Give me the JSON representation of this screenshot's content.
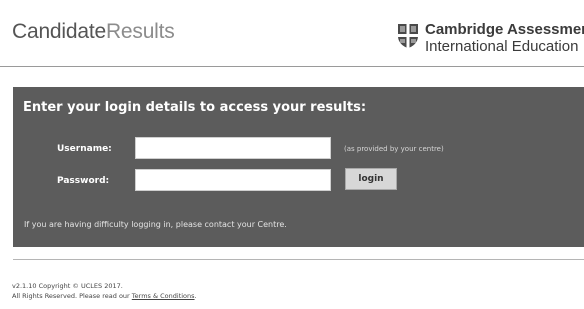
{
  "header": {
    "brand_part1": "Candidate",
    "brand_part2": "Results",
    "org_line1": "Cambridge Assessment",
    "org_line2": "International Education",
    "shield_icon": "cambridge-shield-icon"
  },
  "login": {
    "title": "Enter your login details to access your results:",
    "username_label": "Username:",
    "username_value": "",
    "username_hint": "(as provided by your centre)",
    "password_label": "Password:",
    "password_value": "",
    "login_button": "login",
    "help_text": "If you are having difficulty logging in, please contact your Centre."
  },
  "footer": {
    "version_line": "v2.1.10 Copyright © UCLES 2017.",
    "rights_text": "All Rights Reserved. Please read our",
    "terms_link": "Terms & Conditions",
    "terms_suffix": "."
  },
  "colors": {
    "panel_bg": "#5c5c5c",
    "button_bg": "#d7d7d7",
    "brand_dark": "#555555",
    "brand_light": "#8c8c8c"
  }
}
